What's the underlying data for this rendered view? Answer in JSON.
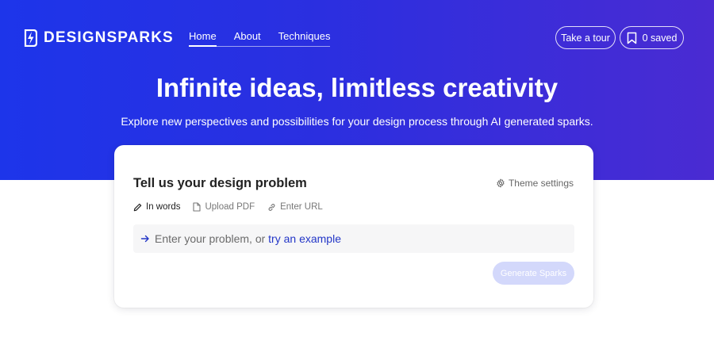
{
  "brand": {
    "name": "DESIGNSPARKS",
    "logo_icon": "bolt-icon"
  },
  "nav": {
    "items": [
      {
        "label": "Home",
        "active": true
      },
      {
        "label": "About",
        "active": false
      },
      {
        "label": "Techniques",
        "active": false
      }
    ]
  },
  "header_actions": {
    "tour_label": "Take a tour",
    "saved_label": "0 saved",
    "saved_icon": "bookmark-icon"
  },
  "hero": {
    "title": "Infinite ideas, limitless creativity",
    "subtitle": "Explore new perspectives and possibilities for your design process through AI generated sparks."
  },
  "card": {
    "title": "Tell us your design problem",
    "theme_settings_label": "Theme settings",
    "input_tabs": [
      {
        "label": "In words",
        "icon": "pencil-icon",
        "active": true
      },
      {
        "label": "Upload PDF",
        "icon": "file-icon",
        "active": false
      },
      {
        "label": "Enter URL",
        "icon": "link-icon",
        "active": false
      }
    ],
    "problem_field": {
      "placeholder": "Enter your problem, or ",
      "example_link": "try an example"
    },
    "generate_label": "Generate Sparks"
  },
  "colors": {
    "hero_gradient_start": "#1d35ea",
    "hero_gradient_end": "#4a2bd2",
    "link": "#2336c7",
    "generate_disabled": "#d3d8fb"
  }
}
